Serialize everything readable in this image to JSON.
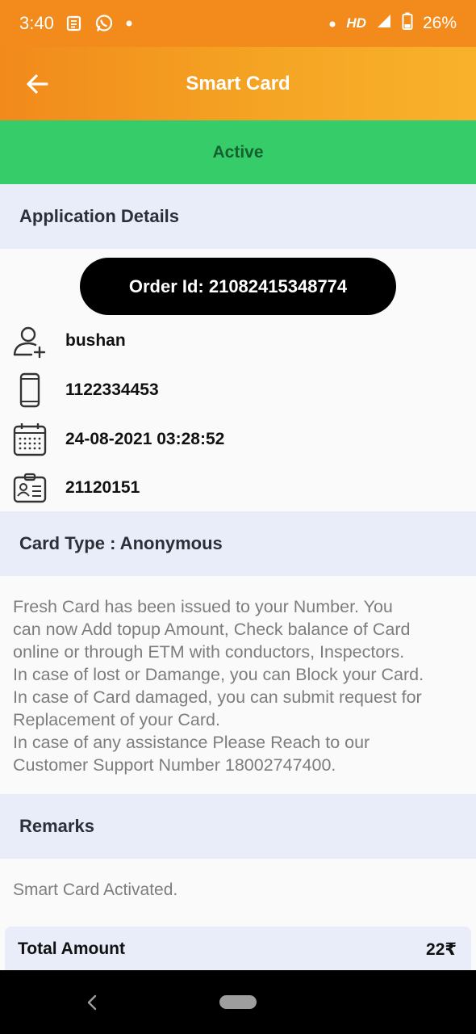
{
  "status_bar": {
    "time": "3:40",
    "network": "HD",
    "battery": "26%"
  },
  "app_bar": {
    "title": "Smart Card",
    "back_icon": "arrow-left-icon"
  },
  "status_banner": {
    "label": "Active",
    "color": "#35cc69"
  },
  "application_details": {
    "heading": "Application Details",
    "order_label": "Order Id: 21082415348774",
    "rows": [
      {
        "icon": "person-add-icon",
        "value": "bushan"
      },
      {
        "icon": "phone-icon",
        "value": "1122334453"
      },
      {
        "icon": "calendar-icon",
        "value": "24-08-2021 03:28:52"
      },
      {
        "icon": "id-card-icon",
        "value": "21120151"
      }
    ]
  },
  "card_type": {
    "heading": "Card Type : Anonymous",
    "description_lines": [
      "Fresh Card has been issued to  your Number. You",
      "can now Add topup Amount, Check balance of Card",
      "online or through ETM with conductors, Inspectors.",
      "In case of lost or Damange, you can Block your Card.",
      "In case of Card damaged, you can submit request for",
      "Replacement of your Card.",
      "In case of any assistance Please Reach to our",
      "Customer Support Number 18002747400."
    ]
  },
  "remarks": {
    "heading": "Remarks",
    "text": "Smart Card Activated."
  },
  "total": {
    "label": "Total Amount",
    "amount": "22₹"
  },
  "colors": {
    "accent": "#f28a1c",
    "active": "#35cc69",
    "section_bg": "#e9edf9"
  }
}
